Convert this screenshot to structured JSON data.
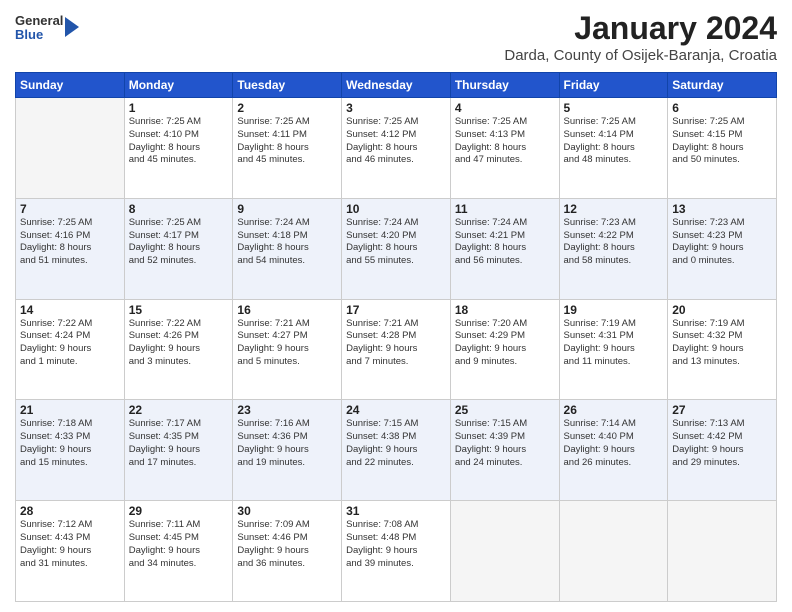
{
  "logo": {
    "general": "General",
    "blue": "Blue"
  },
  "title": "January 2024",
  "subtitle": "Darda, County of Osijek-Baranja, Croatia",
  "days": [
    "Sunday",
    "Monday",
    "Tuesday",
    "Wednesday",
    "Thursday",
    "Friday",
    "Saturday"
  ],
  "weeks": [
    [
      {
        "num": "",
        "info": ""
      },
      {
        "num": "1",
        "info": "Sunrise: 7:25 AM\nSunset: 4:10 PM\nDaylight: 8 hours\nand 45 minutes."
      },
      {
        "num": "2",
        "info": "Sunrise: 7:25 AM\nSunset: 4:11 PM\nDaylight: 8 hours\nand 45 minutes."
      },
      {
        "num": "3",
        "info": "Sunrise: 7:25 AM\nSunset: 4:12 PM\nDaylight: 8 hours\nand 46 minutes."
      },
      {
        "num": "4",
        "info": "Sunrise: 7:25 AM\nSunset: 4:13 PM\nDaylight: 8 hours\nand 47 minutes."
      },
      {
        "num": "5",
        "info": "Sunrise: 7:25 AM\nSunset: 4:14 PM\nDaylight: 8 hours\nand 48 minutes."
      },
      {
        "num": "6",
        "info": "Sunrise: 7:25 AM\nSunset: 4:15 PM\nDaylight: 8 hours\nand 50 minutes."
      }
    ],
    [
      {
        "num": "7",
        "info": "Sunrise: 7:25 AM\nSunset: 4:16 PM\nDaylight: 8 hours\nand 51 minutes."
      },
      {
        "num": "8",
        "info": "Sunrise: 7:25 AM\nSunset: 4:17 PM\nDaylight: 8 hours\nand 52 minutes."
      },
      {
        "num": "9",
        "info": "Sunrise: 7:24 AM\nSunset: 4:18 PM\nDaylight: 8 hours\nand 54 minutes."
      },
      {
        "num": "10",
        "info": "Sunrise: 7:24 AM\nSunset: 4:20 PM\nDaylight: 8 hours\nand 55 minutes."
      },
      {
        "num": "11",
        "info": "Sunrise: 7:24 AM\nSunset: 4:21 PM\nDaylight: 8 hours\nand 56 minutes."
      },
      {
        "num": "12",
        "info": "Sunrise: 7:23 AM\nSunset: 4:22 PM\nDaylight: 8 hours\nand 58 minutes."
      },
      {
        "num": "13",
        "info": "Sunrise: 7:23 AM\nSunset: 4:23 PM\nDaylight: 9 hours\nand 0 minutes."
      }
    ],
    [
      {
        "num": "14",
        "info": "Sunrise: 7:22 AM\nSunset: 4:24 PM\nDaylight: 9 hours\nand 1 minute."
      },
      {
        "num": "15",
        "info": "Sunrise: 7:22 AM\nSunset: 4:26 PM\nDaylight: 9 hours\nand 3 minutes."
      },
      {
        "num": "16",
        "info": "Sunrise: 7:21 AM\nSunset: 4:27 PM\nDaylight: 9 hours\nand 5 minutes."
      },
      {
        "num": "17",
        "info": "Sunrise: 7:21 AM\nSunset: 4:28 PM\nDaylight: 9 hours\nand 7 minutes."
      },
      {
        "num": "18",
        "info": "Sunrise: 7:20 AM\nSunset: 4:29 PM\nDaylight: 9 hours\nand 9 minutes."
      },
      {
        "num": "19",
        "info": "Sunrise: 7:19 AM\nSunset: 4:31 PM\nDaylight: 9 hours\nand 11 minutes."
      },
      {
        "num": "20",
        "info": "Sunrise: 7:19 AM\nSunset: 4:32 PM\nDaylight: 9 hours\nand 13 minutes."
      }
    ],
    [
      {
        "num": "21",
        "info": "Sunrise: 7:18 AM\nSunset: 4:33 PM\nDaylight: 9 hours\nand 15 minutes."
      },
      {
        "num": "22",
        "info": "Sunrise: 7:17 AM\nSunset: 4:35 PM\nDaylight: 9 hours\nand 17 minutes."
      },
      {
        "num": "23",
        "info": "Sunrise: 7:16 AM\nSunset: 4:36 PM\nDaylight: 9 hours\nand 19 minutes."
      },
      {
        "num": "24",
        "info": "Sunrise: 7:15 AM\nSunset: 4:38 PM\nDaylight: 9 hours\nand 22 minutes."
      },
      {
        "num": "25",
        "info": "Sunrise: 7:15 AM\nSunset: 4:39 PM\nDaylight: 9 hours\nand 24 minutes."
      },
      {
        "num": "26",
        "info": "Sunrise: 7:14 AM\nSunset: 4:40 PM\nDaylight: 9 hours\nand 26 minutes."
      },
      {
        "num": "27",
        "info": "Sunrise: 7:13 AM\nSunset: 4:42 PM\nDaylight: 9 hours\nand 29 minutes."
      }
    ],
    [
      {
        "num": "28",
        "info": "Sunrise: 7:12 AM\nSunset: 4:43 PM\nDaylight: 9 hours\nand 31 minutes."
      },
      {
        "num": "29",
        "info": "Sunrise: 7:11 AM\nSunset: 4:45 PM\nDaylight: 9 hours\nand 34 minutes."
      },
      {
        "num": "30",
        "info": "Sunrise: 7:09 AM\nSunset: 4:46 PM\nDaylight: 9 hours\nand 36 minutes."
      },
      {
        "num": "31",
        "info": "Sunrise: 7:08 AM\nSunset: 4:48 PM\nDaylight: 9 hours\nand 39 minutes."
      },
      {
        "num": "",
        "info": ""
      },
      {
        "num": "",
        "info": ""
      },
      {
        "num": "",
        "info": ""
      }
    ]
  ]
}
